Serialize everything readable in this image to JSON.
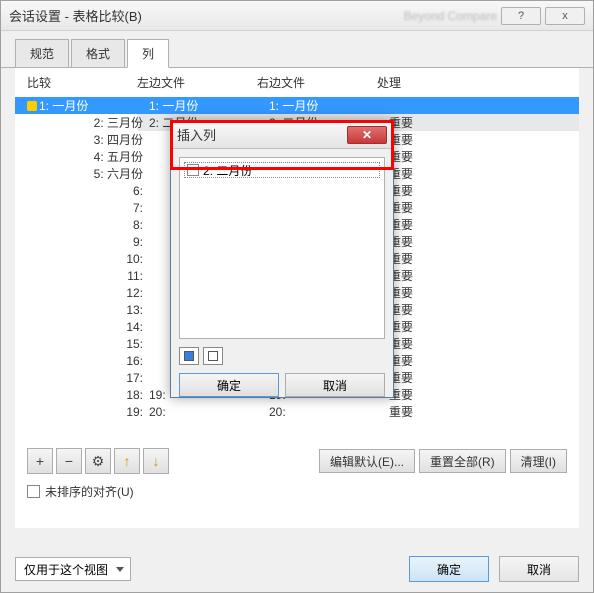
{
  "titlebar": {
    "text": "会话设置 - 表格比较(B)",
    "faded": "Beyond Compare",
    "help": "?",
    "close": "x"
  },
  "tabs": {
    "t0": "规范",
    "t1": "格式",
    "t2": "列"
  },
  "grid": {
    "headers": {
      "compare": "比较",
      "left": "左边文件",
      "right": "右边文件",
      "handle": "处理"
    },
    "rows": [
      {
        "c": "1:  一月份",
        "l": "1:  一月份",
        "r": "1:  一月份",
        "h": "",
        "sel": true,
        "hl": true
      },
      {
        "c": "2:  三月份",
        "l": "2:  二月份",
        "r": "2:  二月份",
        "h": "重要",
        "hl": true
      },
      {
        "c": "3:  四月份",
        "l": "",
        "r": "",
        "h": "重要"
      },
      {
        "c": "4:  五月份",
        "l": "",
        "r": "",
        "h": "重要"
      },
      {
        "c": "5:  六月份",
        "l": "",
        "r": "",
        "h": "重要"
      },
      {
        "c": "6:",
        "l": "",
        "r": "",
        "h": "重要"
      },
      {
        "c": "7:",
        "l": "",
        "r": "",
        "h": "重要"
      },
      {
        "c": "8:",
        "l": "",
        "r": "",
        "h": "重要"
      },
      {
        "c": "9:",
        "l": "",
        "r": "",
        "h": "重要"
      },
      {
        "c": "10:",
        "l": "",
        "r": "",
        "h": "重要"
      },
      {
        "c": "11:",
        "l": "",
        "r": "",
        "h": "重要"
      },
      {
        "c": "12:",
        "l": "",
        "r": "",
        "h": "重要"
      },
      {
        "c": "13:",
        "l": "",
        "r": "",
        "h": "重要"
      },
      {
        "c": "14:",
        "l": "",
        "r": "",
        "h": "重要"
      },
      {
        "c": "15:",
        "l": "",
        "r": "",
        "h": "重要"
      },
      {
        "c": "16:",
        "l": "",
        "r": "",
        "h": "重要"
      },
      {
        "c": "17:",
        "l": "",
        "r": "",
        "h": "重要"
      },
      {
        "c": "18:",
        "l": "19:",
        "r": "19:",
        "h": "重要"
      },
      {
        "c": "19:",
        "l": "20:",
        "r": "20:",
        "h": "重要"
      }
    ]
  },
  "toolbar": {
    "add": "+",
    "remove": "−",
    "settings": "⚙",
    "up": "↑",
    "down": "↓",
    "edit_default": "编辑默认(E)...",
    "reset_all": "重置全部(R)",
    "clear": "清理(I)"
  },
  "unsorted": {
    "label": "未排序的对齐(U)"
  },
  "footer": {
    "scope": "仅用于这个视图",
    "ok": "确定",
    "cancel": "取消"
  },
  "modal": {
    "title": "插入列",
    "item": "2: 二月份",
    "ok": "确定",
    "cancel": "取消"
  }
}
